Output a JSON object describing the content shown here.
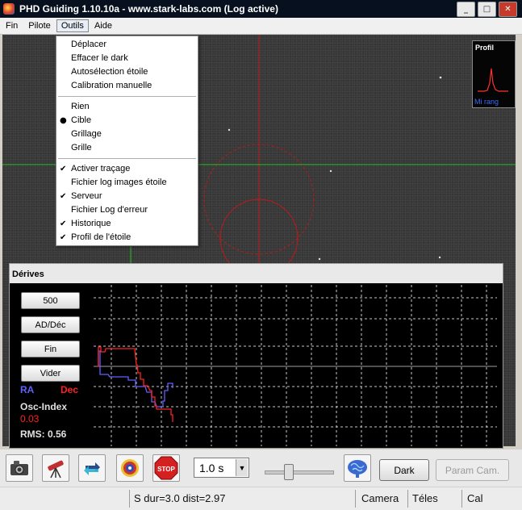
{
  "window": {
    "title": "PHD Guiding 1.10.10a  -  www.stark-labs.com (Log active)"
  },
  "title_buttons": [
    "_",
    "□",
    "✕"
  ],
  "menubar": [
    "Fin",
    "Pilote",
    "Outils",
    "Aide"
  ],
  "outils_menu": {
    "group1": [
      "Déplacer",
      "Effacer le dark",
      "Autosélection étoile",
      "Calibration manuelle"
    ],
    "group2": [
      {
        "label": "Rien",
        "mark": ""
      },
      {
        "label": "Cible",
        "mark": "●"
      },
      {
        "label": "Grillage",
        "mark": ""
      },
      {
        "label": "Grille",
        "mark": ""
      }
    ],
    "group3": [
      {
        "label": "Activer traçage",
        "mark": "✔"
      },
      {
        "label": "Fichier log images étoile",
        "mark": ""
      },
      {
        "label": "Serveur",
        "mark": "✔"
      },
      {
        "label": "Fichier Log d'erreur",
        "mark": ""
      },
      {
        "label": "Historique",
        "mark": "✔"
      },
      {
        "label": "Profil de l'étoile",
        "mark": "✔"
      }
    ]
  },
  "profile": {
    "title": "Profil",
    "label": "Mi rang",
    "color": "#ff3030"
  },
  "drift": {
    "title": "Dérives",
    "buttons": [
      "500",
      "AD/Déc",
      "Fin",
      "Vider"
    ],
    "ra_label": "RA",
    "dec_label": "Dec",
    "osc_label": "Osc-Index",
    "osc_value": "0.03",
    "rms": "RMS: 0.56",
    "ra_color": "#6060ff",
    "dec_color": "#ff2020"
  },
  "toolbar": {
    "exposure": "1.0 s",
    "dark_label": "Dark",
    "param_label": "Param Cam.",
    "stop_label": "STOP"
  },
  "statusbar": {
    "status": "S dur=3.0 dist=2.97",
    "camera": "Camera",
    "teles": "Téles",
    "cal": "Cal"
  }
}
